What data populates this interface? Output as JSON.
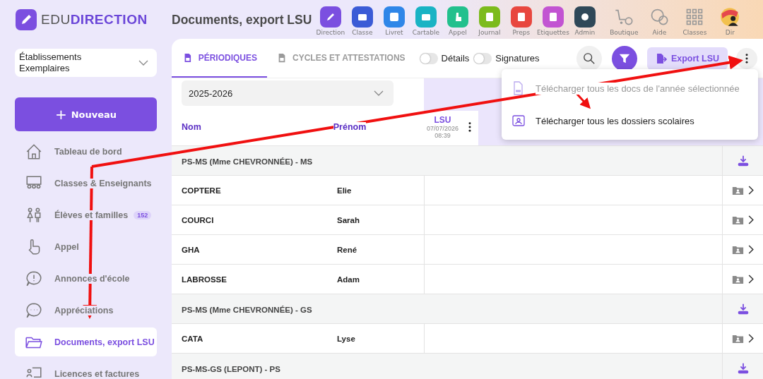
{
  "logo": {
    "light": "EDU",
    "bold": "DIRECTION"
  },
  "page_title": "Documents, export LSU",
  "apps": [
    {
      "label": "Direction",
      "color": "#7b4fe0"
    },
    {
      "label": "Classe",
      "color": "#3b5bd6"
    },
    {
      "label": "Livret",
      "color": "#2f86e8"
    },
    {
      "label": "Cartable",
      "color": "#19b3c4"
    },
    {
      "label": "Appel",
      "color": "#22c08d"
    },
    {
      "label": "Journal",
      "color": "#7cbb1c"
    },
    {
      "label": "Preps",
      "color": "#e8473f"
    },
    {
      "label": "Etiquettes",
      "color": "#c254d2"
    },
    {
      "label": "Admin",
      "color": "#2f4858"
    }
  ],
  "tools": [
    {
      "label": "Boutique",
      "kind": "cart"
    },
    {
      "label": "Aide",
      "kind": "help"
    },
    {
      "label": "Classes",
      "kind": "grid"
    },
    {
      "label": "Dir",
      "kind": "avatar"
    }
  ],
  "school_select": {
    "value": "Établissements Exemplaires"
  },
  "new_button": {
    "icon": "+",
    "label": "Nouveau"
  },
  "sidebar": [
    {
      "label": "Tableau de bord",
      "kind": "home",
      "selected": false
    },
    {
      "label": "Classes & Enseignants",
      "kind": "class",
      "selected": false
    },
    {
      "label": "Élèves et familles",
      "kind": "kids",
      "selected": false,
      "badge": "152"
    },
    {
      "label": "Appel",
      "kind": "hand",
      "selected": false
    },
    {
      "label": "Annonces d'école",
      "kind": "alert",
      "selected": false
    },
    {
      "label": "Appréciations",
      "kind": "chat",
      "selected": false
    },
    {
      "label": "Documents, export LSU",
      "kind": "folder",
      "selected": true
    },
    {
      "label": "Licences et factures",
      "kind": "license",
      "selected": false
    }
  ],
  "tabs": [
    {
      "label": "PÉRIODIQUES",
      "selected": true
    },
    {
      "label": "CYCLES ET ATTESTATIONS",
      "selected": false
    }
  ],
  "toggles": [
    {
      "label": "Détails",
      "on": false
    },
    {
      "label": "Signatures",
      "on": false
    }
  ],
  "export_button": "Export LSU",
  "menu": [
    {
      "label": "Télécharger tous les docs de l'année sélectionnée",
      "kind": "zip",
      "disabled": true
    },
    {
      "label": "Télécharger tous les dossiers scolaires",
      "kind": "folder",
      "disabled": false
    }
  ],
  "year_select": {
    "value": "2025-2026"
  },
  "columns": {
    "nom": "Nom",
    "prenom": "Prénom",
    "doc": {
      "title": "LSU",
      "date": "07/07/2026",
      "time": "08:39"
    }
  },
  "groups": [
    {
      "title": "PS-MS (Mme CHEVRONNÉE) - MS",
      "rows": [
        {
          "nom": "COPTERE",
          "prenom": "Elie"
        },
        {
          "nom": "COURCI",
          "prenom": "Sarah"
        },
        {
          "nom": "GHA",
          "prenom": "René"
        },
        {
          "nom": "LABROSSE",
          "prenom": "Adam"
        }
      ]
    },
    {
      "title": "PS-MS (Mme CHEVRONNÉE) - GS",
      "rows": [
        {
          "nom": "CATA",
          "prenom": "Lyse"
        }
      ]
    },
    {
      "title": "PS-MS-GS (LEPONT) - PS"
    }
  ]
}
